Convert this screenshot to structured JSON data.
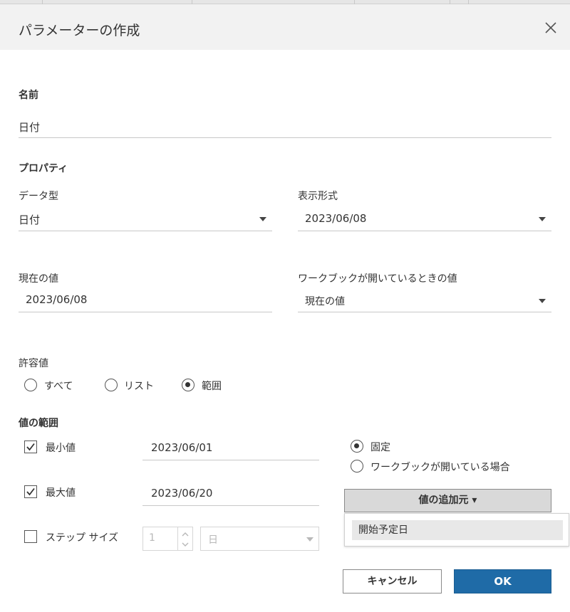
{
  "dialog": {
    "title": "パラメーターの作成"
  },
  "name": {
    "label": "名前",
    "value": "日付"
  },
  "properties": {
    "label": "プロパティ",
    "data_type": {
      "label": "データ型",
      "value": "日付"
    },
    "display_format": {
      "label": "表示形式",
      "value": "2023/06/08"
    },
    "current_value": {
      "label": "現在の値",
      "value": "2023/06/08"
    },
    "workbook_open_value": {
      "label": "ワークブックが開いているときの値",
      "value": "現在の値"
    }
  },
  "allowable_values": {
    "label": "許容値",
    "options": [
      {
        "label": "すべて",
        "checked": false
      },
      {
        "label": "リスト",
        "checked": false
      },
      {
        "label": "範囲",
        "checked": true
      }
    ]
  },
  "range": {
    "label": "値の範囲",
    "minimum": {
      "label": "最小値",
      "checked": true,
      "value": "2023/06/01"
    },
    "maximum": {
      "label": "最大値",
      "checked": true,
      "value": "2023/06/20"
    },
    "step": {
      "label": "ステップ サイズ",
      "checked": false,
      "value": "1",
      "unit": "日"
    },
    "mode_options": [
      {
        "label": "固定",
        "checked": true
      },
      {
        "label": "ワークブックが開いている場合",
        "checked": false
      }
    ],
    "add_from_button": {
      "label": "値の追加元 ▾"
    },
    "add_from_menu": [
      "開始予定日"
    ]
  },
  "footer": {
    "cancel_label": "キャンセル",
    "ok_label": "OK"
  },
  "colors": {
    "ok_button": "#1f6ba7",
    "title_bar": "#f2f2f2"
  }
}
